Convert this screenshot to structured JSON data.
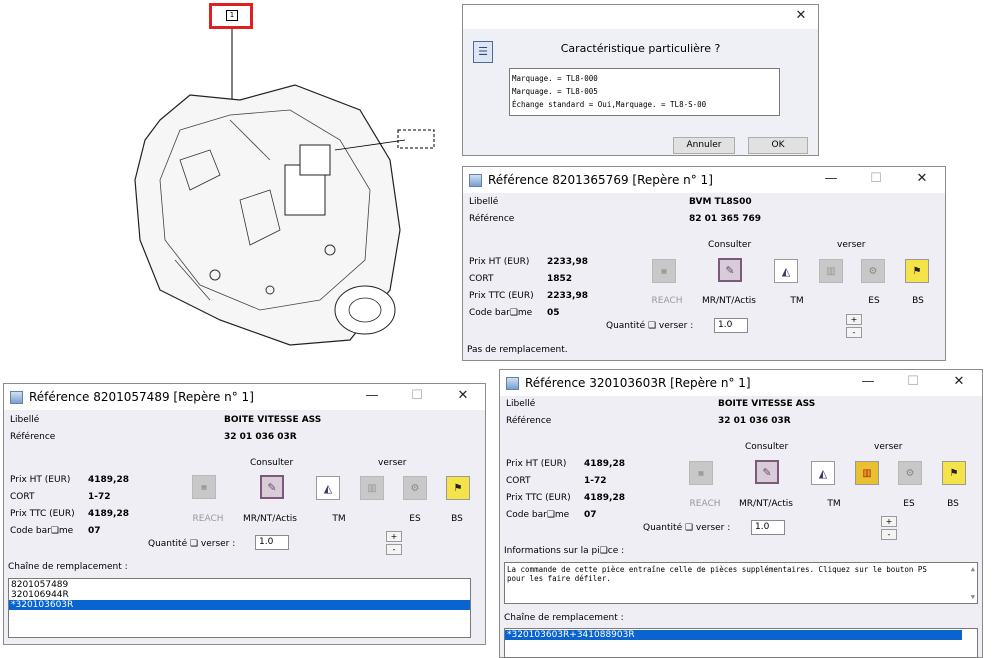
{
  "drawing": {
    "callout_number": "1"
  },
  "dialog": {
    "question": "Caractéristique particulière ?",
    "options": [
      "Marquage. = TL8-000",
      "Marquage. = TL8-005",
      "Échange standard  = Oui,Marquage. = TL8-S-00"
    ],
    "cancel_label": "Annuler",
    "ok_label": "OK"
  },
  "win1": {
    "title": "Référence 8201365769 [Repère n° 1]",
    "libelle_label": "Libellé",
    "libelle_value": "BVM TL8S00",
    "reference_label": "Référence",
    "reference_value": "82 01 365 769",
    "prix_ht_label": "Prix HT (EUR)",
    "prix_ht_value": "2233,98",
    "cort_label": "CORT",
    "cort_value": "1852",
    "prix_ttc_label": "Prix TTC (EUR)",
    "prix_ttc_value": "2233,98",
    "code_bareme_label": "Code bar❑me",
    "code_bareme_value": "05",
    "consulter_label": "Consulter",
    "verser_label": "verser",
    "reach_label": "REACH",
    "mr_label": "MR/NT/Actis",
    "tm_label": "TM",
    "es_label": "ES",
    "bs_label": "BS",
    "quantite_label": "Quantité ❑ verser :",
    "quantite_value": "1.0",
    "status": "Pas de remplacement."
  },
  "win2": {
    "title": "Référence 8201057489 [Repère n° 1]",
    "libelle_label": "Libellé",
    "libelle_value": "BOITE VITESSE ASS",
    "reference_label": "Référence",
    "reference_value": "32 01 036 03R",
    "prix_ht_label": "Prix HT (EUR)",
    "prix_ht_value": "4189,28",
    "cort_label": "CORT",
    "cort_value": "1-72",
    "prix_ttc_label": "Prix TTC (EUR)",
    "prix_ttc_value": "4189,28",
    "code_bareme_label": "Code bar❑me",
    "code_bareme_value": "07",
    "consulter_label": "Consulter",
    "verser_label": "verser",
    "reach_label": "REACH",
    "mr_label": "MR/NT/Actis",
    "tm_label": "TM",
    "es_label": "ES",
    "bs_label": "BS",
    "quantite_label": "Quantité ❑ verser :",
    "quantite_value": "1.0",
    "chain_label": "Chaîne de remplacement :",
    "chain": [
      "8201057489",
      "320106944R",
      "*320103603R"
    ]
  },
  "win3": {
    "title": "Référence 320103603R [Repère n° 1]",
    "libelle_label": "Libellé",
    "libelle_value": "BOITE VITESSE ASS",
    "reference_label": "Référence",
    "reference_value": "32 01 036 03R",
    "prix_ht_label": "Prix HT (EUR)",
    "prix_ht_value": "4189,28",
    "cort_label": "CORT",
    "cort_value": "1-72",
    "prix_ttc_label": "Prix TTC (EUR)",
    "prix_ttc_value": "4189,28",
    "code_bareme_label": "Code bar❑me",
    "code_bareme_value": "07",
    "consulter_label": "Consulter",
    "verser_label": "verser",
    "reach_label": "REACH",
    "mr_label": "MR/NT/Actis",
    "tm_label": "TM",
    "es_label": "ES",
    "bs_label": "BS",
    "quantite_label": "Quantité ❑ verser :",
    "quantite_value": "1.0",
    "info_label": "Informations sur la pi❑ce :",
    "info_text": "La commande de cette pièce entraîne celle de pièces supplémentaires. Cliquez sur le bouton PS pour les faire défiler.",
    "chain_label": "Chaîne de remplacement :",
    "chain": [
      "*320103603R+341088903R"
    ]
  },
  "colors": {
    "selection": "#0a64d0",
    "callout": "#e02020",
    "window_bg": "#eeeef4"
  }
}
